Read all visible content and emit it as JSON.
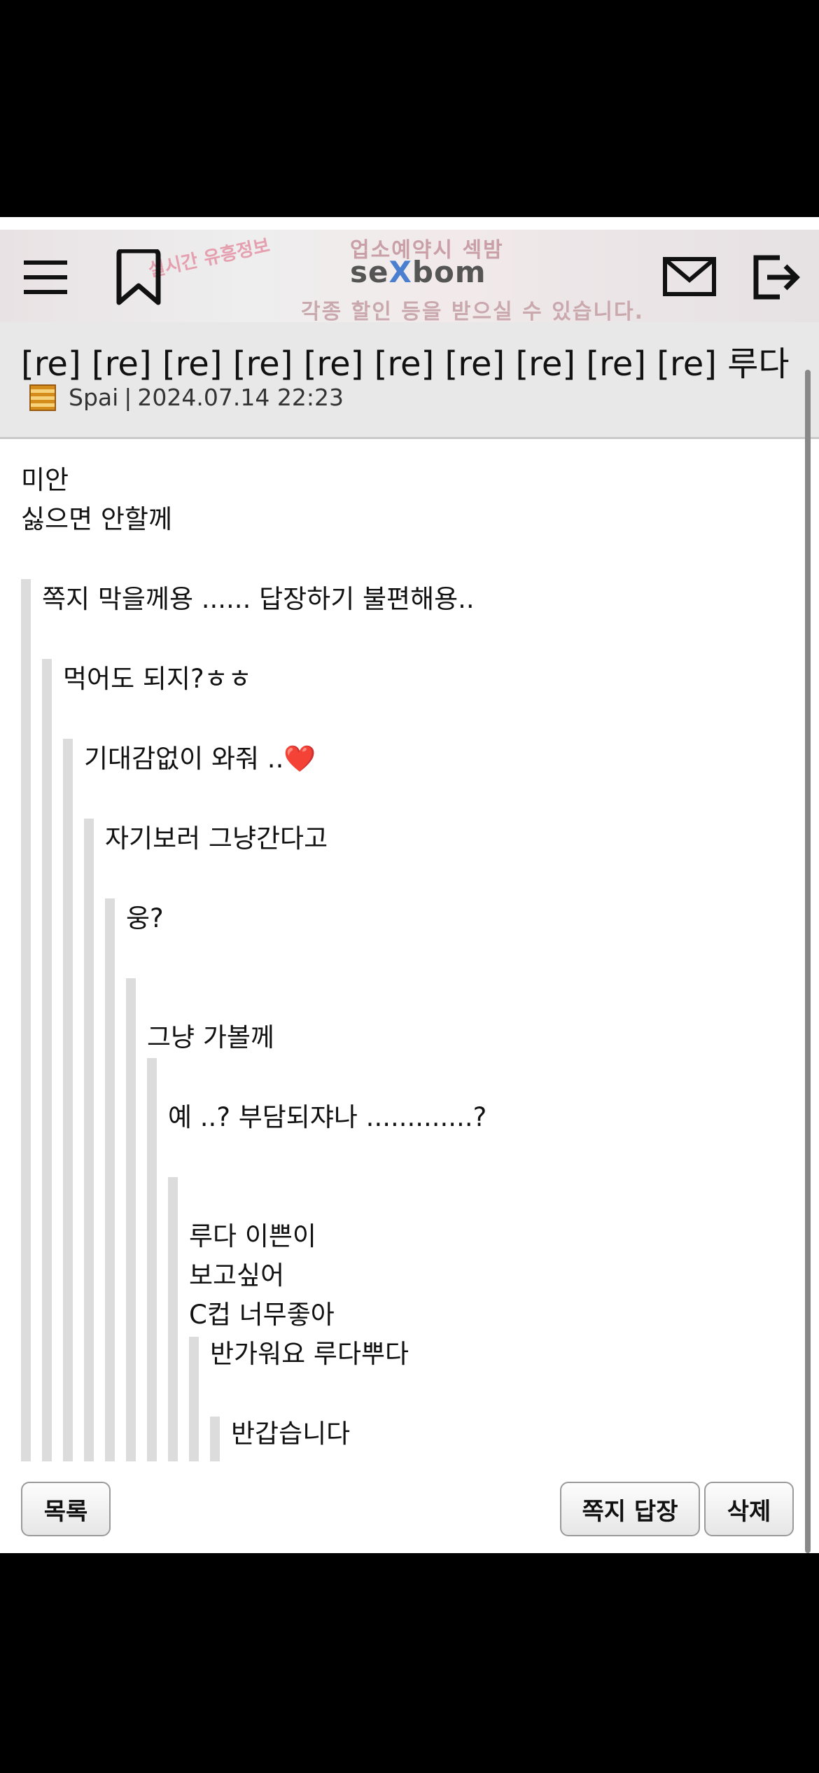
{
  "header": {
    "logo_prefix": "se",
    "logo_x": "X",
    "logo_suffix": "bom",
    "banner_line1": "업소예약시 섹밤",
    "banner_line2": "각종 할인 등을 받으실 수 있습니다.",
    "banner_line3": "실시간 유흥정보",
    "icons": [
      "menu-icon",
      "bookmark-icon",
      "mail-icon",
      "logout-icon"
    ]
  },
  "post": {
    "title": "[re] [re] [re] [re] [re] [re] [re] [re] [re] [re] 루다",
    "author": "Spai",
    "separator": "|",
    "datetime": "2024.07.14 22:23"
  },
  "body": {
    "lines": [
      "미안",
      "싫으면 안할께",
      "쪽지 막을께용 ...... 답장하기 불편해용..",
      "먹어도 되지?ㅎㅎ",
      "기대감없이 와줘 ..❤️",
      "자기보러 그냥간다고",
      "웅?",
      "그냥 가볼께",
      "예 ..? 부담되쟈나 .............?",
      "루다 이쁜이",
      "보고싶어",
      "C컵 너무좋아",
      "반가워요 루다뿌다",
      "반갑습니다"
    ]
  },
  "buttons": {
    "list": "목록",
    "reply": "쪽지 답장",
    "delete": "삭제"
  }
}
